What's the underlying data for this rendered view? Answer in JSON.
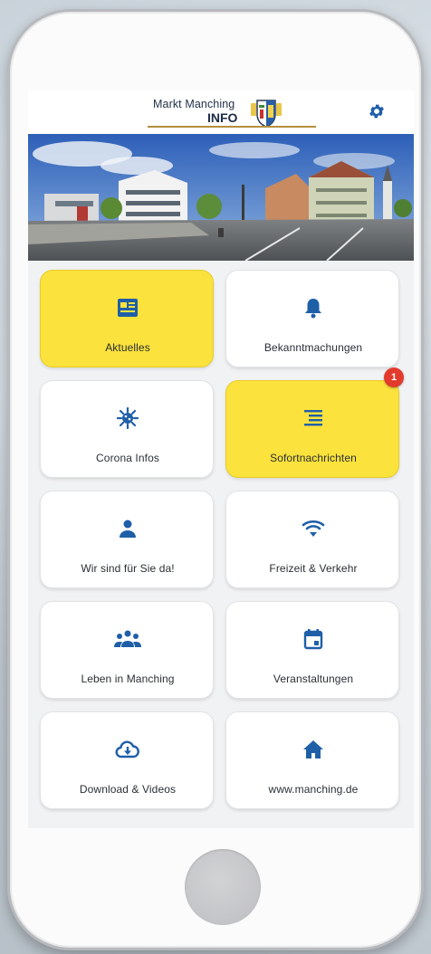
{
  "header": {
    "brand_line1": "Markt Manching",
    "brand_line2": "INFO",
    "brand_icon": "coat-of-arms",
    "settings_icon": "gear-icon"
  },
  "banner": {
    "description_icon": "town-panorama-photo"
  },
  "tiles": [
    {
      "label": "Aktuelles",
      "icon": "newspaper-icon",
      "highlight": true
    },
    {
      "label": "Bekanntmachungen",
      "icon": "bell-icon",
      "highlight": false
    },
    {
      "label": "Corona Infos",
      "icon": "virus-icon",
      "highlight": false
    },
    {
      "label": "Sofortnachrichten",
      "icon": "list-icon",
      "highlight": true,
      "badge": "1"
    },
    {
      "label": "Wir sind für Sie da!",
      "icon": "person-icon",
      "highlight": false
    },
    {
      "label": "Freizeit & Verkehr",
      "icon": "wifi-icon",
      "highlight": false
    },
    {
      "label": "Leben in Manching",
      "icon": "group-icon",
      "highlight": false
    },
    {
      "label": "Veranstaltungen",
      "icon": "calendar-icon",
      "highlight": false
    },
    {
      "label": "Download & Videos",
      "icon": "cloud-download-icon",
      "highlight": false
    },
    {
      "label": "www.manching.de",
      "icon": "home-icon",
      "highlight": false
    }
  ],
  "colors": {
    "accent_blue": "#1f5fa8",
    "highlight_yellow": "#fbe23c",
    "badge_red": "#e23b2e"
  }
}
